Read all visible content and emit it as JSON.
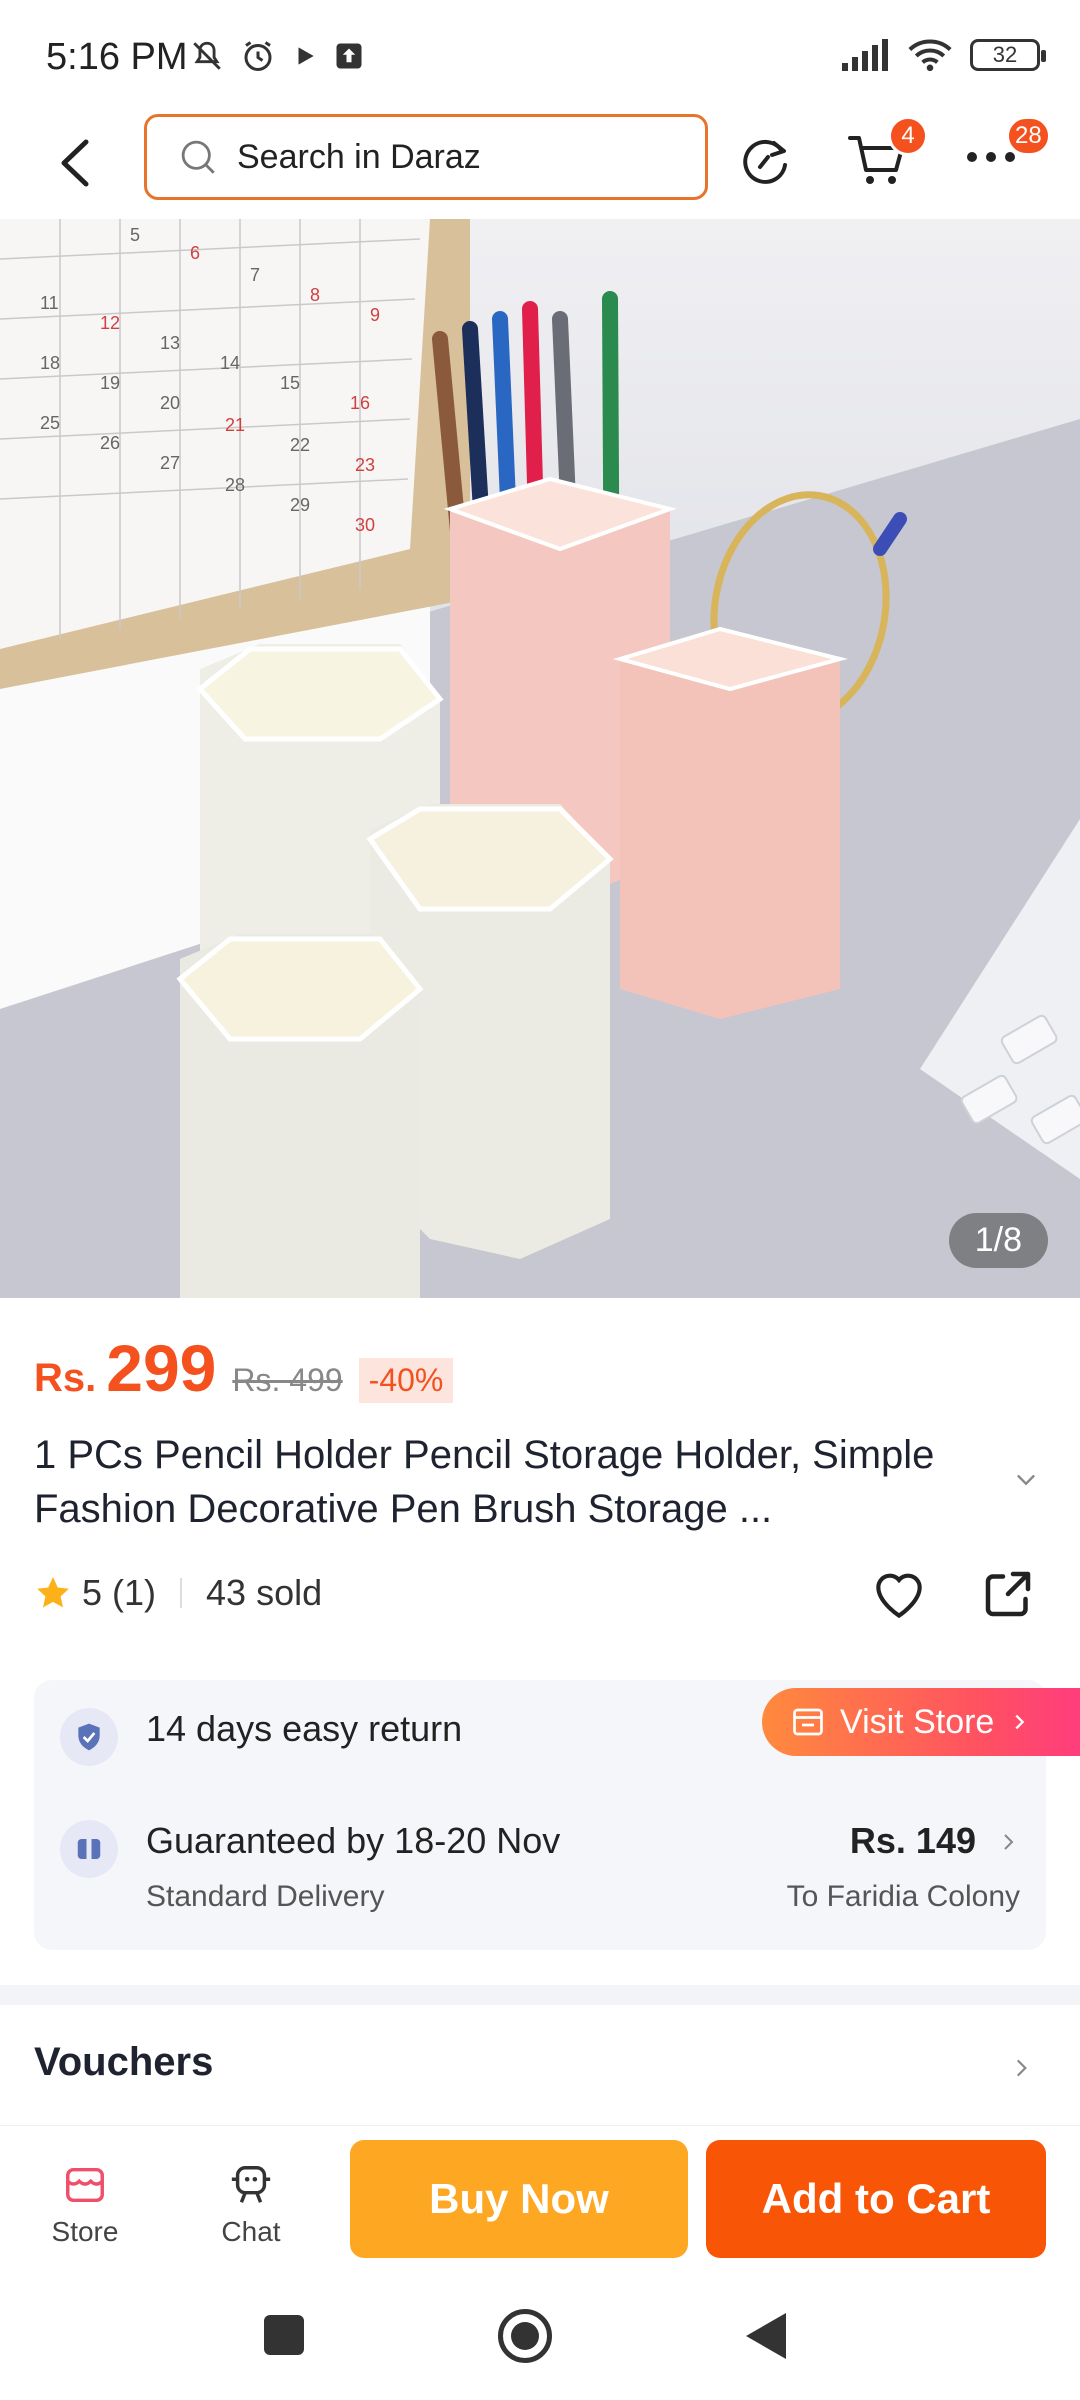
{
  "status_bar": {
    "time": "5:16 PM",
    "battery": "32"
  },
  "header": {
    "search_placeholder": "Search in Daraz",
    "cart_badge": "4",
    "more_badge": "28"
  },
  "gallery": {
    "counter": "1/8"
  },
  "product": {
    "currency": "Rs.",
    "price": "299",
    "original_price": "Rs. 499",
    "discount": "-40%",
    "title": "1 PCs Pencil Holder Pencil Storage Holder, Simple Fashion Decorative Pen Brush Storage ...",
    "rating": "5",
    "rating_count": "(1)",
    "sold": "43 sold"
  },
  "service": {
    "return": "14 days easy return",
    "visit_store": "Visit Store",
    "guarantee": "Guaranteed by 18-20 Nov",
    "delivery_type": "Standard Delivery",
    "shipping_fee": "Rs. 149",
    "destination": "To Faridia Colony"
  },
  "vouchers": {
    "label": "Vouchers"
  },
  "bottom_bar": {
    "store": "Store",
    "chat": "Chat",
    "buy_now": "Buy Now",
    "add_to_cart": "Add to Cart"
  },
  "colors": {
    "accent": "#f85606",
    "buy_now": "#fda722",
    "price": "#f4511e"
  }
}
